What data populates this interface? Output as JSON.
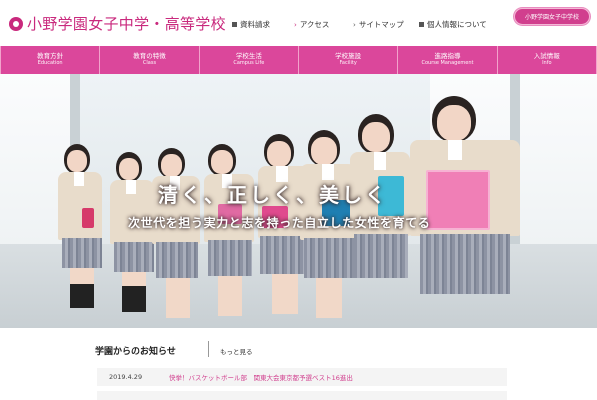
{
  "header": {
    "school_name": "小野学園女子中学・高等学校",
    "util_links": [
      {
        "label": "資料請求",
        "icon": "document-square-icon"
      },
      {
        "label": "アクセス",
        "icon": "arrow-right-icon"
      },
      {
        "label": "サイトマップ",
        "icon": "chevron-right-icon"
      },
      {
        "label": "個人情報について",
        "icon": "square-bullet-icon"
      }
    ],
    "pink_button_label": "小野学園女子中学校"
  },
  "main_nav": [
    {
      "jp": "教育方針",
      "en": "Education"
    },
    {
      "jp": "教育の特徴",
      "en": "Class"
    },
    {
      "jp": "学校生活",
      "en": "Campus Life"
    },
    {
      "jp": "学校施設",
      "en": "Facility"
    },
    {
      "jp": "進路指導",
      "en": "Course Management"
    },
    {
      "jp": "入試情報",
      "en": "Info"
    }
  ],
  "hero": {
    "headline": "清く、正しく、美しく",
    "subline": "次世代を担う実力と志を持った自立した女性を育てる"
  },
  "news": {
    "title": "学園からのお知らせ",
    "more_label": "もっと見る",
    "items": [
      {
        "date": "2019.4.29",
        "text": "快挙！バスケットボール部　関東大会東京都予選ベスト16進出"
      }
    ]
  },
  "colors": {
    "brand_pink": "#db479b",
    "logo_magenta": "#c9297d",
    "news_link": "#d13f8e"
  }
}
